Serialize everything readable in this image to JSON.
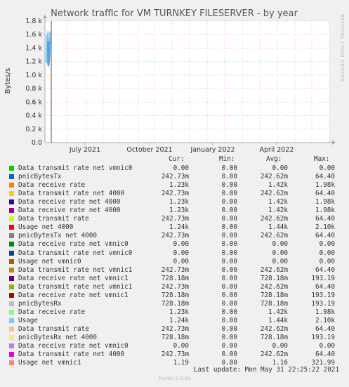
{
  "chart_data": {
    "type": "line",
    "title": "Network traffic for VM TURNKEY FILESERVER - by year",
    "ylabel": "Bytes/s",
    "xlabel": "",
    "side_label": "RRDTOOL / TOBI OETIKER",
    "ylim": [
      0,
      1800
    ],
    "y_ticks": [
      "0.0",
      "0.2 k",
      "0.4 k",
      "0.6 k",
      "0.8 k",
      "1.0 k",
      "1.2 k",
      "1.4 k",
      "1.6 k",
      "1.8 k"
    ],
    "x_ticks": [
      "July 2021",
      "October 2021",
      "January 2022",
      "April 2022"
    ],
    "grid": true,
    "series_spike": {
      "values": [
        1180,
        1600,
        1250,
        1650,
        1120,
        1560,
        1200,
        1640,
        1300
      ],
      "color": "#7ec8f0"
    },
    "legend_header": {
      "cur": "Cur:",
      "min": "Min:",
      "avg": "Avg:",
      "max": "Max:"
    },
    "legend": [
      {
        "name": "Data transmit rate net vmnic0",
        "color": "#00cc00",
        "cur": "0.00",
        "min": "0.00",
        "avg": "0.00",
        "max": "0.00"
      },
      {
        "name": "pnicBytesTx",
        "color": "#0066b3",
        "cur": "242.73m",
        "min": "0.00",
        "avg": "242.62m",
        "max": "64.40"
      },
      {
        "name": "Data receive rate",
        "color": "#ff8000",
        "cur": "1.23k",
        "min": "0.00",
        "avg": "1.42k",
        "max": "1.98k"
      },
      {
        "name": "Data transmit rate net 4000",
        "color": "#ffcc00",
        "cur": "242.73m",
        "min": "0.00",
        "avg": "242.62m",
        "max": "64.40"
      },
      {
        "name": "Data receive rate net 4000",
        "color": "#330099",
        "cur": "1.23k",
        "min": "0.00",
        "avg": "1.42k",
        "max": "1.98k"
      },
      {
        "name": "Data receive rate net 4000",
        "color": "#990099",
        "cur": "1.23k",
        "min": "0.00",
        "avg": "1.42k",
        "max": "1.98k"
      },
      {
        "name": "Data transmit rate",
        "color": "#ccff00",
        "cur": "242.73m",
        "min": "0.00",
        "avg": "242.62m",
        "max": "64.40"
      },
      {
        "name": "Usage net 4000",
        "color": "#ff0000",
        "cur": "1.24k",
        "min": "0.00",
        "avg": "1.44k",
        "max": "2.10k"
      },
      {
        "name": "pnicBytesTx net 4000",
        "color": "#808080",
        "cur": "242.73m",
        "min": "0.00",
        "avg": "242.62m",
        "max": "64.40"
      },
      {
        "name": "Data receive rate net vmnic0",
        "color": "#008f00",
        "cur": "0.00",
        "min": "0.00",
        "avg": "0.00",
        "max": "0.00"
      },
      {
        "name": "Data transmit rate net vmnic0",
        "color": "#00487d",
        "cur": "0.00",
        "min": "0.00",
        "avg": "0.00",
        "max": "0.00"
      },
      {
        "name": "Usage net vmnic0",
        "color": "#b35a00",
        "cur": "0.00",
        "min": "0.00",
        "avg": "0.00",
        "max": "0.00"
      },
      {
        "name": "Data transmit rate net vmnic1",
        "color": "#b38f00",
        "cur": "242.73m",
        "min": "0.00",
        "avg": "242.62m",
        "max": "64.40"
      },
      {
        "name": "Data receive rate net vmnic1",
        "color": "#6b006b",
        "cur": "728.18m",
        "min": "0.00",
        "avg": "728.18m",
        "max": "193.19"
      },
      {
        "name": "Data transmit rate net vmnic1",
        "color": "#8fb300",
        "cur": "242.73m",
        "min": "0.00",
        "avg": "242.62m",
        "max": "64.40"
      },
      {
        "name": "Data receive rate net vmnic1",
        "color": "#b30000",
        "cur": "728.18m",
        "min": "0.00",
        "avg": "728.18m",
        "max": "193.19"
      },
      {
        "name": "pnicBytesRx",
        "color": "#bebebe",
        "cur": "728.18m",
        "min": "0.00",
        "avg": "728.18m",
        "max": "193.19"
      },
      {
        "name": "Data receive rate",
        "color": "#80ff80",
        "cur": "1.23k",
        "min": "0.00",
        "avg": "1.42k",
        "max": "1.98k"
      },
      {
        "name": "Usage",
        "color": "#80c9ff",
        "cur": "1.24k",
        "min": "0.00",
        "avg": "1.44k",
        "max": "2.10k"
      },
      {
        "name": "Data transmit rate",
        "color": "#ffc080",
        "cur": "242.73m",
        "min": "0.00",
        "avg": "242.62m",
        "max": "64.40"
      },
      {
        "name": "pnicBytesRx net 4000",
        "color": "#ffe680",
        "cur": "728.18m",
        "min": "0.00",
        "avg": "728.18m",
        "max": "193.19"
      },
      {
        "name": "Data receive rate net vmnic0",
        "color": "#aa80ff",
        "cur": "0.00",
        "min": "0.00",
        "avg": "0.00",
        "max": "0.00"
      },
      {
        "name": "Data transmit rate net 4000",
        "color": "#ee00cc",
        "cur": "242.73m",
        "min": "0.00",
        "avg": "242.62m",
        "max": "64.40"
      },
      {
        "name": "Usage net vmnic1",
        "color": "#ff8080",
        "cur": "1.19",
        "min": "0.00",
        "avg": "1.16",
        "max": "321.99"
      }
    ],
    "last_update": "Last update: Mon May 31 22:25:22 2021",
    "footer": "Munin 2.0.69"
  }
}
